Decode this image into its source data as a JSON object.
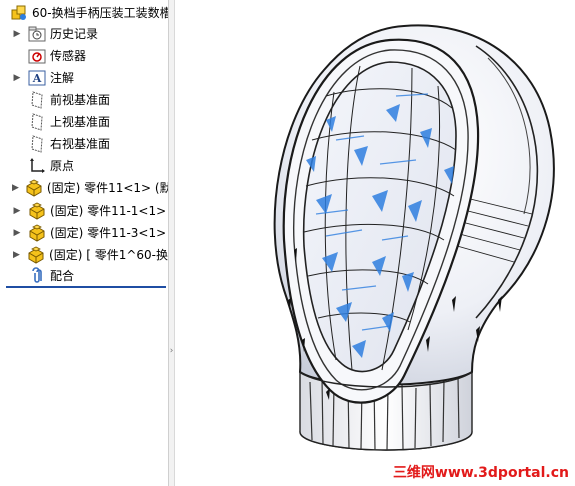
{
  "tree": {
    "root_label": "60-换档手柄压装工装数槽",
    "items": [
      {
        "label": "历史记录",
        "icon": "history-folder-icon"
      },
      {
        "label": "传感器",
        "icon": "sensor-icon"
      },
      {
        "label": "注解",
        "icon": "annotation-icon"
      },
      {
        "label": "前视基准面",
        "icon": "plane-icon"
      },
      {
        "label": "上视基准面",
        "icon": "plane-icon"
      },
      {
        "label": "右视基准面",
        "icon": "plane-icon"
      },
      {
        "label": "原点",
        "icon": "origin-icon"
      },
      {
        "label": "(固定) 零件11<1> (默",
        "icon": "part-icon"
      },
      {
        "label": "(固定) 零件11-1<1>",
        "icon": "part-icon"
      },
      {
        "label": "(固定) 零件11-3<1>",
        "icon": "part-icon"
      },
      {
        "label": "(固定) [ 零件1^60-换",
        "icon": "part-icon"
      },
      {
        "label": "配合",
        "icon": "mates-icon"
      }
    ]
  },
  "watermark": "三维网www.3dportal.cn",
  "colors": {
    "accent_blue": "#2f7fe0",
    "part_yellow": "#f5c21b",
    "rollback_bar": "#1f4ea3",
    "watermark_red": "#e21a1a"
  }
}
